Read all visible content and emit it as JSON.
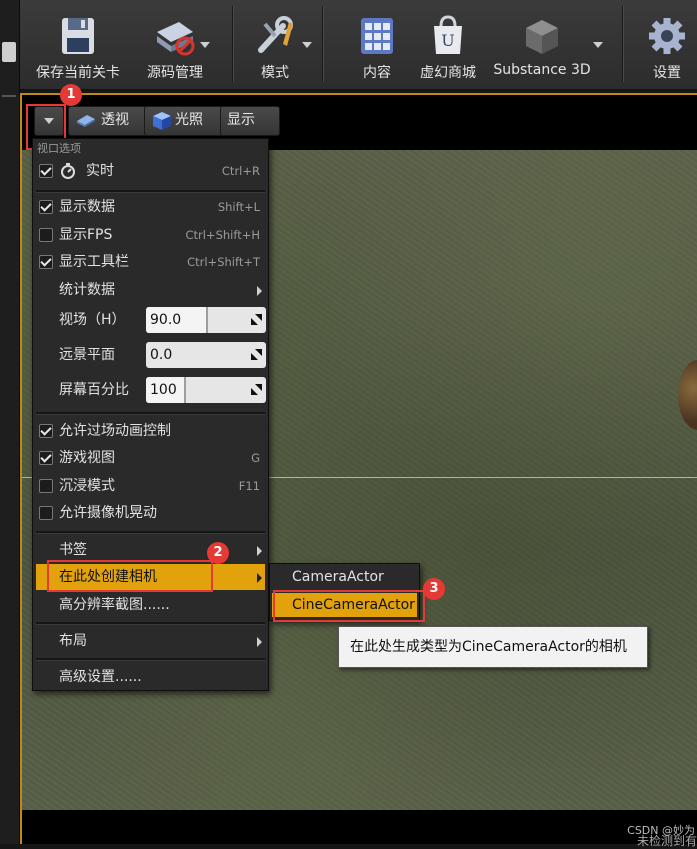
{
  "toolbar": {
    "buttons": [
      {
        "label": "保存当前关卡",
        "icon": "floppy-save-icon"
      },
      {
        "label": "源码管理",
        "icon": "source-control-icon"
      },
      {
        "label": "模式",
        "icon": "modes-tools-icon"
      },
      {
        "label": "内容",
        "icon": "content-grid-icon"
      },
      {
        "label": "虚幻商城",
        "icon": "marketplace-bag-icon"
      },
      {
        "label": "Substance 3D",
        "icon": "substance-cube-icon"
      },
      {
        "label": "设置",
        "icon": "settings-gear-icon"
      }
    ]
  },
  "viewport": {
    "buttons": {
      "perspective": "透视",
      "lighting": "光照",
      "show": "显示"
    },
    "watermark_line1": "CSDN @妙为",
    "watermark_line2": "未检测到有"
  },
  "menu": {
    "header": "视口选项",
    "realtime": {
      "label": "实时",
      "shortcut": "Ctrl+R",
      "checked": true
    },
    "show_stats": {
      "label": "显示数据",
      "shortcut": "Shift+L",
      "checked": true
    },
    "show_fps": {
      "label": "显示FPS",
      "shortcut": "Ctrl+Shift+H",
      "checked": false
    },
    "show_toolbar": {
      "label": "显示工具栏",
      "shortcut": "Ctrl+Shift+T",
      "checked": true
    },
    "stats": {
      "label": "统计数据"
    },
    "fov": {
      "label": "视场（H）",
      "value": "90.0"
    },
    "far_plane": {
      "label": "远景平面",
      "value": "0.0"
    },
    "screen_pct": {
      "label": "屏幕百分比",
      "value": "100"
    },
    "allow_cinematic": {
      "label": "允许过场动画控制",
      "checked": true
    },
    "game_view": {
      "label": "游戏视图",
      "shortcut": "G",
      "checked": true
    },
    "immersive": {
      "label": "沉浸模式",
      "shortcut": "F11",
      "checked": false
    },
    "camera_shake": {
      "label": "允许摄像机晃动",
      "checked": false
    },
    "bookmarks": {
      "label": "书签"
    },
    "create_camera": {
      "label": "在此处创建相机"
    },
    "hires_screenshot": {
      "label": "高分辨率截图......"
    },
    "layout": {
      "label": "布局"
    },
    "advanced": {
      "label": "高级设置......"
    }
  },
  "submenu": {
    "camera_actor": "CameraActor",
    "cine_camera_actor": "CineCameraActor"
  },
  "tooltip": "在此处生成类型为CineCameraActor的相机",
  "annotations": [
    "1",
    "2",
    "3"
  ],
  "colors": {
    "accent": "#e2a20b",
    "highlight_box": "#e53935"
  }
}
